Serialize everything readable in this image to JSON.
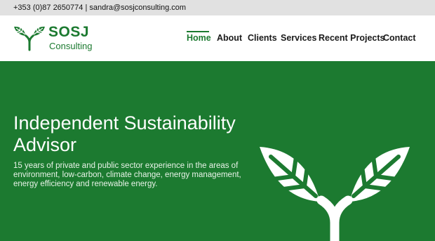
{
  "topbar": {
    "contact": "+353 (0)87 2650774 | sandra@sosjconsulting.com"
  },
  "logo": {
    "name": "SOSJ",
    "subtitle": "Consulting",
    "icon": "leaf-sprout-icon"
  },
  "nav": {
    "items": [
      {
        "label": "Home",
        "active": true
      },
      {
        "label": "About",
        "active": false
      },
      {
        "label": "Clients",
        "active": false
      },
      {
        "label": "Services",
        "active": false
      },
      {
        "label": "Recent Projects",
        "active": false
      },
      {
        "label": "Contact",
        "active": false
      }
    ]
  },
  "hero": {
    "title": "Independent Sustainability Advisor",
    "description": "15 years of private and public sector experience in the areas of environment, low-carbon, climate change, energy management, energy efficiency and renewable energy.",
    "illustration": "leaf-sprout-icon"
  },
  "colors": {
    "brand": "#1c7a30",
    "topbar": "#e1e1e1",
    "text": "#1a1a1a"
  }
}
